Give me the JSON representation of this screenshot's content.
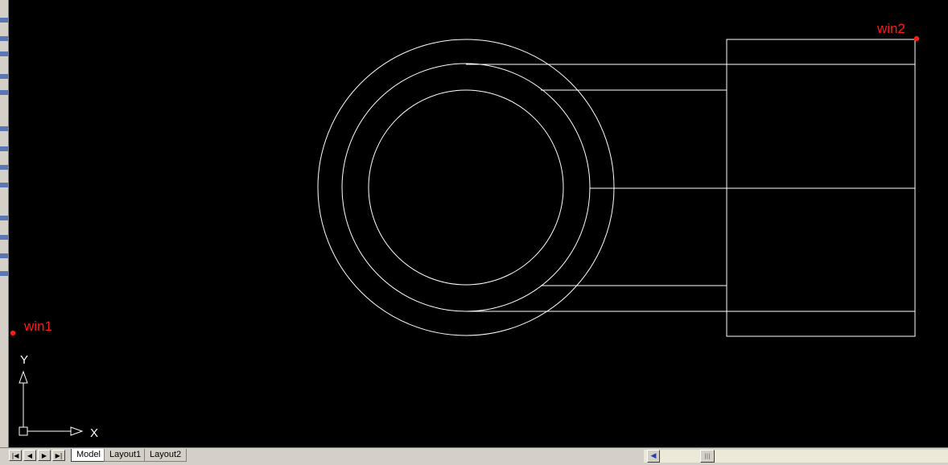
{
  "drawing": {
    "background_color": "#000000",
    "line_color": "#ffffff",
    "marker_color": "#ff1a1a",
    "points": {
      "win1": {
        "label": "win1"
      },
      "win2": {
        "label": "win2"
      }
    },
    "ucs": {
      "x_label": "X",
      "y_label": "Y"
    }
  },
  "layout_tabs": {
    "nav_buttons": [
      "first-tab",
      "prev-tab",
      "next-tab",
      "last-tab"
    ],
    "tabs": [
      {
        "label": "Model",
        "active": true
      },
      {
        "label": "Layout1",
        "active": false
      },
      {
        "label": "Layout2",
        "active": false
      }
    ]
  },
  "scrollbar": {
    "left_arrow_icon": "chevron-left-icon",
    "thumb_icon": "grip-icon"
  }
}
